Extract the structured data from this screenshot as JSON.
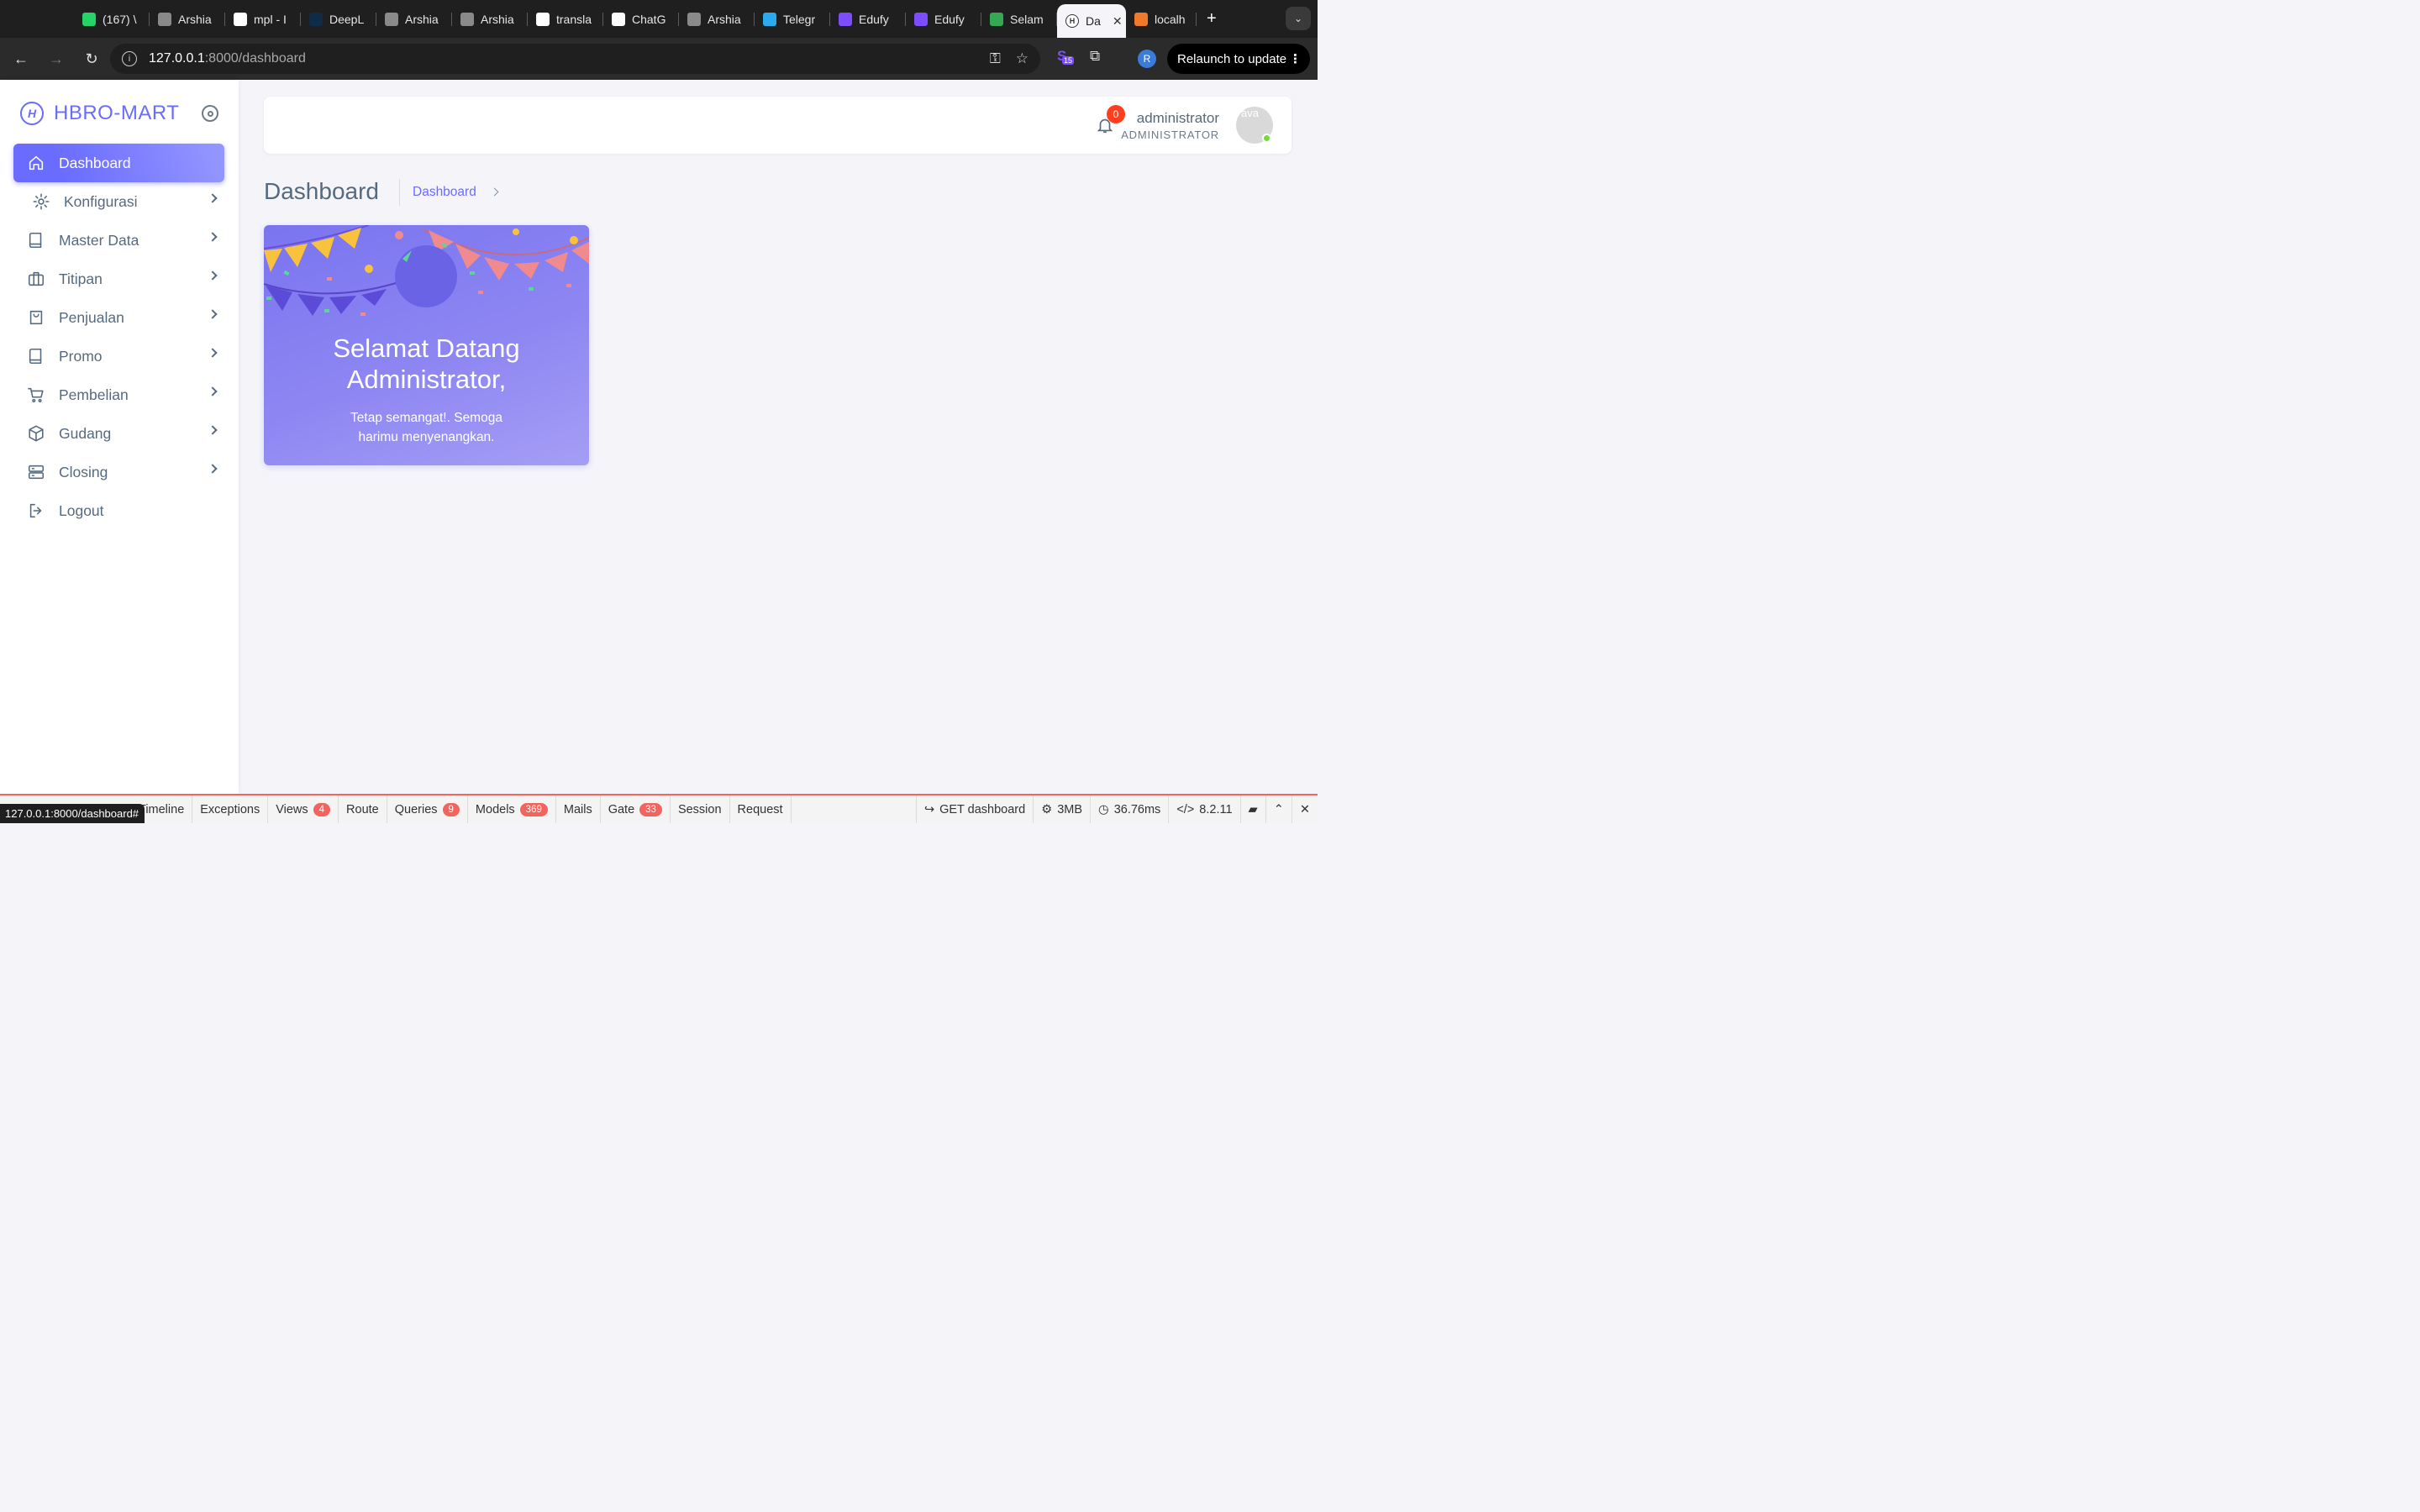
{
  "browser": {
    "tabs": [
      {
        "label": "(167) \\",
        "favicon": "whatsapp-icon",
        "color": "#25d366"
      },
      {
        "label": "Arshia",
        "favicon": "image-icon",
        "color": "#8a8a8a"
      },
      {
        "label": "mpl - I",
        "favicon": "google-icon",
        "color": "#ffffff"
      },
      {
        "label": "DeepL",
        "favicon": "deepl-icon",
        "color": "#0f2b46"
      },
      {
        "label": "Arshia",
        "favicon": "image-icon",
        "color": "#8a8a8a"
      },
      {
        "label": "Arshia",
        "favicon": "image-icon",
        "color": "#8a8a8a"
      },
      {
        "label": "transla",
        "favicon": "google-icon",
        "color": "#ffffff"
      },
      {
        "label": "ChatG",
        "favicon": "chatgpt-icon",
        "color": "#ffffff"
      },
      {
        "label": "Arshia",
        "favicon": "image-icon",
        "color": "#8a8a8a"
      },
      {
        "label": "Telegr",
        "favicon": "telegram-icon",
        "color": "#2aabee"
      },
      {
        "label": "Edufy",
        "favicon": "edufy-icon",
        "color": "#7b4dff"
      },
      {
        "label": "Edufy",
        "favicon": "edufy-icon",
        "color": "#7b4dff"
      },
      {
        "label": "Selam",
        "favicon": "sheets-icon",
        "color": "#34a853"
      }
    ],
    "active_tab": {
      "label": "Da",
      "favicon": "hbro-icon"
    },
    "extra_tab": {
      "label": "localh",
      "favicon": "xampp-icon"
    },
    "new_tab": "+",
    "url_host": "127.0.0.1",
    "url_path": ":8000/dashboard",
    "ext_badge": "15",
    "profile_initial": "R",
    "relaunch_label": "Relaunch to update",
    "status_url": "127.0.0.1:8000/dashboard#"
  },
  "sidebar": {
    "brand": "HBRO-MART",
    "brand_logo": "H",
    "items": [
      {
        "label": "Dashboard",
        "icon": "home-icon",
        "active": true,
        "has_children": false
      },
      {
        "label": "Konfigurasi",
        "icon": "gear-icon",
        "active": false,
        "has_children": true
      },
      {
        "label": "Master Data",
        "icon": "book-icon",
        "active": false,
        "has_children": true
      },
      {
        "label": "Titipan",
        "icon": "briefcase-icon",
        "active": false,
        "has_children": true
      },
      {
        "label": "Penjualan",
        "icon": "shopping-bag-icon",
        "active": false,
        "has_children": true
      },
      {
        "label": "Promo",
        "icon": "book-icon",
        "active": false,
        "has_children": true
      },
      {
        "label": "Pembelian",
        "icon": "cart-icon",
        "active": false,
        "has_children": true
      },
      {
        "label": "Gudang",
        "icon": "box-icon",
        "active": false,
        "has_children": true
      },
      {
        "label": "Closing",
        "icon": "server-icon",
        "active": false,
        "has_children": true
      },
      {
        "label": "Logout",
        "icon": "logout-icon",
        "active": false,
        "has_children": false
      }
    ]
  },
  "navbar": {
    "notification_count": "0",
    "user_name": "administrator",
    "user_role": "ADMINISTRATOR",
    "avatar_alt": "ava"
  },
  "page": {
    "title": "Dashboard",
    "breadcrumb": "Dashboard"
  },
  "welcome": {
    "title_line1": "Selamat Datang",
    "title_line2": "Administrator,",
    "subtitle_line1": "Tetap semangat!. Semoga",
    "subtitle_line2": "harimu menyenangkan."
  },
  "debugbar": {
    "tabs": [
      {
        "label": "Timeline",
        "badge": null
      },
      {
        "label": "Exceptions",
        "badge": null
      },
      {
        "label": "Views",
        "badge": "4"
      },
      {
        "label": "Route",
        "badge": null
      },
      {
        "label": "Queries",
        "badge": "9"
      },
      {
        "label": "Models",
        "badge": "369"
      },
      {
        "label": "Mails",
        "badge": null
      },
      {
        "label": "Gate",
        "badge": "33"
      },
      {
        "label": "Session",
        "badge": null
      },
      {
        "label": "Request",
        "badge": null
      }
    ],
    "request": "GET dashboard",
    "memory": "3MB",
    "time": "36.76ms",
    "php_version": "8.2.11"
  },
  "colors": {
    "primary": "#696cff",
    "badge_red": "#ff3e1d",
    "online_green": "#71dd37",
    "debug_red": "#f4645f"
  }
}
